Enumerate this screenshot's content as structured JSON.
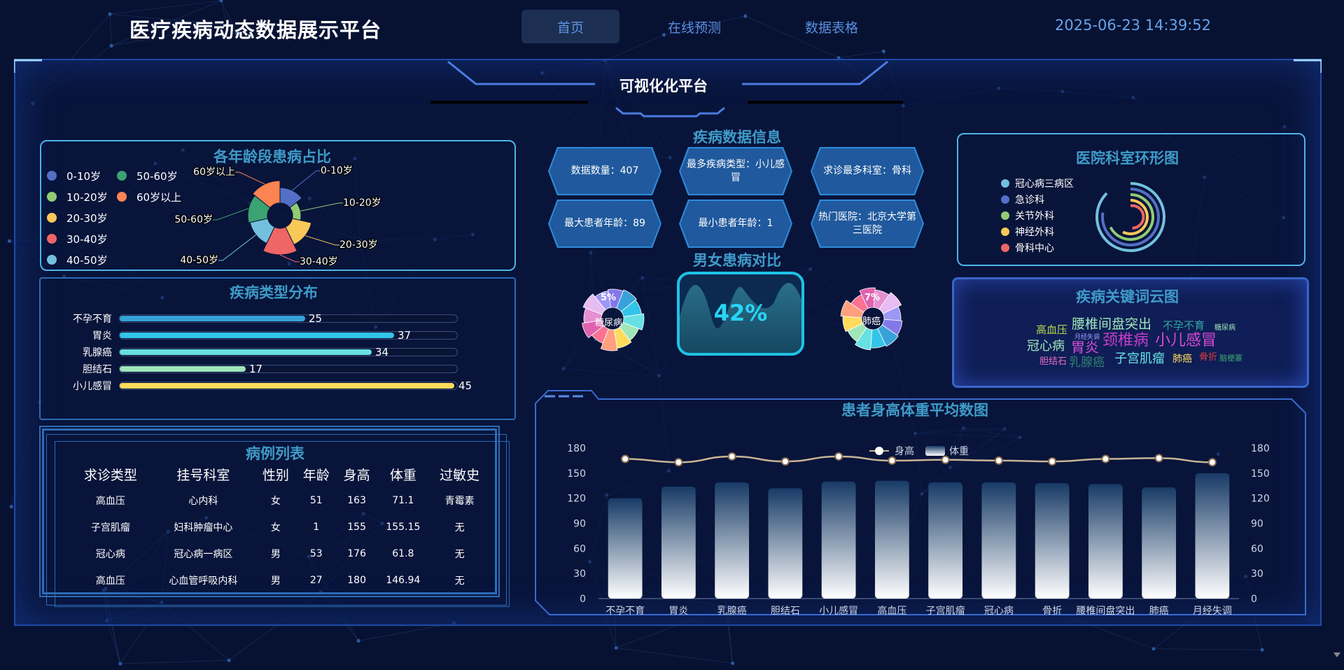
{
  "header": {
    "title": "医疗疾病动态数据展示平台",
    "tabs": [
      "首页",
      "在线预测",
      "数据表格"
    ],
    "clock": "2025-06-23 14:39:52"
  },
  "platform_title": "可视化化平台",
  "age": {
    "title": "各年龄段患病占比",
    "legend": [
      {
        "label": "0-10岁",
        "color": "#5470c6"
      },
      {
        "label": "10-20岁",
        "color": "#91cc75"
      },
      {
        "label": "20-30岁",
        "color": "#fac858"
      },
      {
        "label": "30-40岁",
        "color": "#ee6666"
      },
      {
        "label": "40-50岁",
        "color": "#73c0de"
      },
      {
        "label": "50-60岁",
        "color": "#3ba272"
      },
      {
        "label": "60岁以上",
        "color": "#fc8452"
      }
    ],
    "pie_labels": [
      "0-10岁",
      "10-20岁",
      "20-30岁",
      "30-40岁",
      "40-50岁",
      "50-60岁",
      "60岁以上"
    ]
  },
  "disease_dist": {
    "title": "疾病类型分布",
    "items": [
      {
        "label": "不孕不育",
        "value": "25",
        "color": "#37a2da"
      },
      {
        "label": "胃炎",
        "value": "37",
        "color": "#32c5e9"
      },
      {
        "label": "乳腺癌",
        "value": "34",
        "color": "#67e0e3"
      },
      {
        "label": "胆结石",
        "value": "17",
        "color": "#9fe6b8"
      },
      {
        "label": "小儿感冒",
        "value": "45",
        "color": "#ffdb5c"
      }
    ]
  },
  "cases": {
    "title": "病例列表",
    "headers": [
      "求诊类型",
      "挂号科室",
      "性别",
      "年龄",
      "身高",
      "体重",
      "过敏史"
    ],
    "rows": [
      [
        "高血压",
        "心内科",
        "女",
        "51",
        "163",
        "71.1",
        "青霉素"
      ],
      [
        "子宫肌瘤",
        "妇科肿瘤中心",
        "女",
        "1",
        "155",
        "155.15",
        "无"
      ],
      [
        "冠心病",
        "冠心病一病区",
        "男",
        "53",
        "176",
        "61.8",
        "无"
      ],
      [
        "高血压",
        "心血管呼吸内科",
        "男",
        "27",
        "180",
        "146.94",
        "无"
      ]
    ]
  },
  "info": {
    "title": "疾病数据信息",
    "cards": [
      "数据数量：407",
      "最多疾病类型：小儿感冒",
      "求诊最多科室：骨科",
      "最大患者年龄：89",
      "最小患者年龄：1",
      "热门医院：北京大学第三医院"
    ]
  },
  "gender": {
    "title": "男女患病对比",
    "percent": "42%",
    "left_pct": "5%",
    "left_label": "糖尿病",
    "right_pct": "7%",
    "right_label": "肺癌"
  },
  "dept": {
    "title": "医院科室环形图",
    "legend": [
      {
        "label": "冠心病三病区",
        "color": "#73c0de"
      },
      {
        "label": "急诊科",
        "color": "#5470c6"
      },
      {
        "label": "关节外科",
        "color": "#91cc75"
      },
      {
        "label": "神经外科",
        "color": "#fac858"
      },
      {
        "label": "骨科中心",
        "color": "#ee6666"
      }
    ]
  },
  "cloud": {
    "title": "疾病关键词云图",
    "words": [
      {
        "text": "腰椎间盘突出",
        "color": "#9fe6b8"
      },
      {
        "text": "不孕不育",
        "color": "#2fa7a0"
      },
      {
        "text": "糖尿病",
        "color": "#9fe6b8"
      },
      {
        "text": "高血压",
        "color": "#b6d84a"
      },
      {
        "text": "月经失调",
        "color": "#a0a0ff"
      },
      {
        "text": "颈椎病",
        "color": "#c23ec9"
      },
      {
        "text": "小儿感冒",
        "color": "#d84bd4"
      },
      {
        "text": "冠心病",
        "color": "#9fe6b8"
      },
      {
        "text": "胃炎",
        "color": "#d64fd6"
      },
      {
        "text": "子宫肌瘤",
        "color": "#67e0e3"
      },
      {
        "text": "肺癌",
        "color": "#ffdb5c"
      },
      {
        "text": "骨折",
        "color": "#e03c3c"
      },
      {
        "text": "脑梗塞",
        "color": "#3ba272"
      },
      {
        "text": "胆结石",
        "color": "#e86fcc"
      },
      {
        "text": "乳腺癌",
        "color": "#2f7f6f"
      }
    ]
  },
  "chart_data": {
    "type": "bar",
    "title": "患者身高体重平均数图",
    "categories": [
      "不孕不育",
      "胃炎",
      "乳腺癌",
      "胆结石",
      "小儿感冒",
      "高血压",
      "子宫肌瘤",
      "冠心病",
      "骨折",
      "腰椎间盘突出",
      "肺癌",
      "月经失调"
    ],
    "series": [
      {
        "name": "身高",
        "type": "line",
        "values": [
          167,
          163,
          170,
          164,
          170,
          165,
          166,
          165,
          164,
          167,
          168,
          163
        ]
      },
      {
        "name": "体重",
        "type": "bar",
        "values": [
          120,
          134,
          139,
          132,
          140,
          141,
          139,
          139,
          138,
          137,
          133,
          150
        ]
      }
    ],
    "yticks": [
      "0",
      "30",
      "60",
      "90",
      "120",
      "150",
      "180"
    ],
    "ylim": [
      0,
      180
    ],
    "legend": "top-right"
  }
}
